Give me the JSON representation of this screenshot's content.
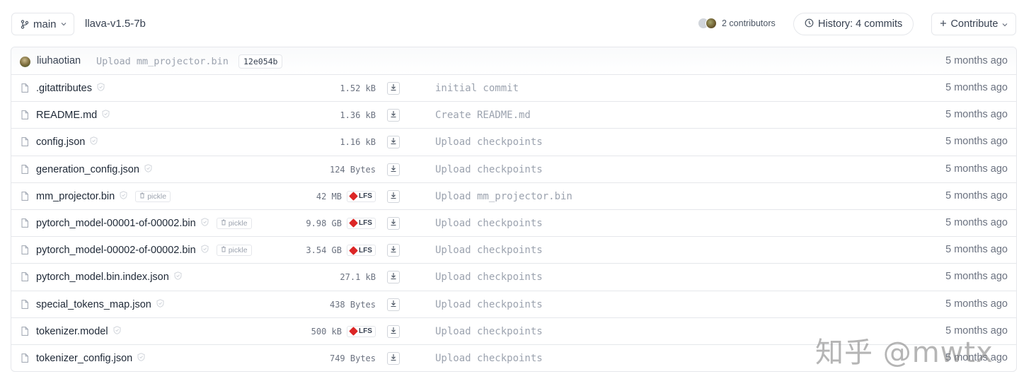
{
  "header": {
    "branch": "main",
    "repo_name": "llava-v1.5-7b",
    "contributors_label": "2 contributors",
    "history_label": "History: 4 commits",
    "contribute_label": "Contribute"
  },
  "last_commit": {
    "author": "liuhaotian",
    "message": "Upload mm_projector.bin",
    "hash": "12e054b",
    "time": "5 months ago"
  },
  "files": [
    {
      "name": ".gitattributes",
      "size": "1.52 kB",
      "lfs": false,
      "pickle": false,
      "commit": "initial commit",
      "time": "5 months ago"
    },
    {
      "name": "README.md",
      "size": "1.36 kB",
      "lfs": false,
      "pickle": false,
      "commit": "Create README.md",
      "time": "5 months ago"
    },
    {
      "name": "config.json",
      "size": "1.16 kB",
      "lfs": false,
      "pickle": false,
      "commit": "Upload checkpoints",
      "time": "5 months ago"
    },
    {
      "name": "generation_config.json",
      "size": "124 Bytes",
      "lfs": false,
      "pickle": false,
      "commit": "Upload checkpoints",
      "time": "5 months ago"
    },
    {
      "name": "mm_projector.bin",
      "size": "42 MB",
      "lfs": true,
      "pickle": true,
      "commit": "Upload mm_projector.bin",
      "time": "5 months ago"
    },
    {
      "name": "pytorch_model-00001-of-00002.bin",
      "size": "9.98 GB",
      "lfs": true,
      "pickle": true,
      "commit": "Upload checkpoints",
      "time": "5 months ago"
    },
    {
      "name": "pytorch_model-00002-of-00002.bin",
      "size": "3.54 GB",
      "lfs": true,
      "pickle": true,
      "commit": "Upload checkpoints",
      "time": "5 months ago"
    },
    {
      "name": "pytorch_model.bin.index.json",
      "size": "27.1 kB",
      "lfs": false,
      "pickle": false,
      "commit": "Upload checkpoints",
      "time": "5 months ago"
    },
    {
      "name": "special_tokens_map.json",
      "size": "438 Bytes",
      "lfs": false,
      "pickle": false,
      "commit": "Upload checkpoints",
      "time": "5 months ago"
    },
    {
      "name": "tokenizer.model",
      "size": "500 kB",
      "lfs": true,
      "pickle": false,
      "commit": "Upload checkpoints",
      "time": "5 months ago"
    },
    {
      "name": "tokenizer_config.json",
      "size": "749 Bytes",
      "lfs": false,
      "pickle": false,
      "commit": "Upload checkpoints",
      "time": "5 months ago"
    }
  ],
  "badges": {
    "pickle": "pickle",
    "lfs": "LFS"
  },
  "watermark": "知乎 @mwtx",
  "colors": {
    "lfs_red": "#dc2626",
    "muted_text": "#9ca3af",
    "border": "#e5e7eb"
  },
  "icons": [
    "branch-icon",
    "chevron-down-icon",
    "history-icon",
    "plus-icon",
    "file-icon",
    "safe-check-icon",
    "pickle-icon",
    "download-icon"
  ]
}
